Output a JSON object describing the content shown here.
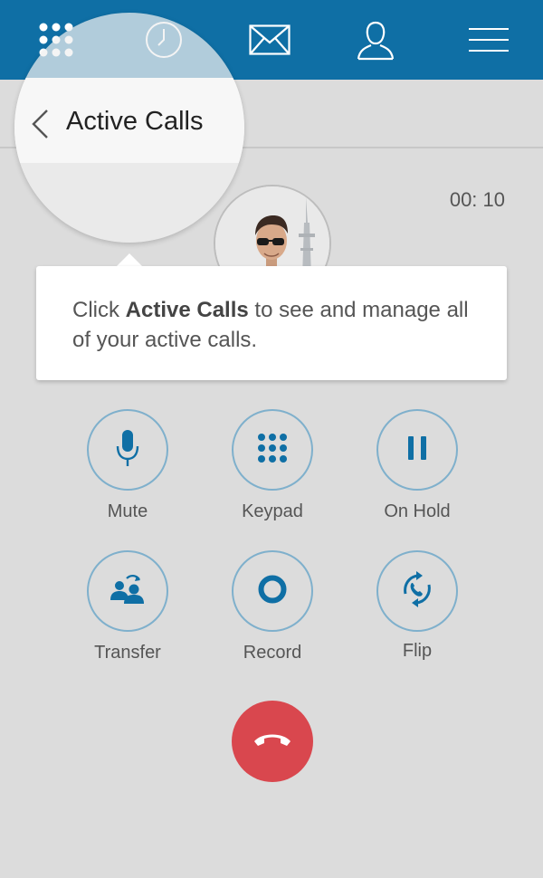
{
  "nav": {
    "items": [
      {
        "icon": "keypad-grid-icon"
      },
      {
        "icon": "clock-icon"
      },
      {
        "icon": "envelope-icon"
      },
      {
        "icon": "contact-icon"
      },
      {
        "icon": "menu-icon"
      }
    ],
    "background": "#0f6fa5"
  },
  "header": {
    "title": "Active Calls",
    "back_icon": "chevron-left-icon"
  },
  "call": {
    "timer": "00: 10"
  },
  "tooltip": {
    "prefix": "Click ",
    "highlight": "Active Calls",
    "suffix": " to see and manage all of your active calls."
  },
  "actions": [
    {
      "label": "Mute",
      "icon": "microphone-icon"
    },
    {
      "label": "Keypad",
      "icon": "keypad-icon"
    },
    {
      "label": "On Hold",
      "icon": "pause-icon"
    },
    {
      "label": "Transfer",
      "icon": "transfer-icon"
    },
    {
      "label": "Record",
      "icon": "record-icon"
    },
    {
      "label": "Flip",
      "icon": "flip-icon"
    }
  ],
  "end_call": {
    "icon": "hang-up-icon",
    "color": "#d9474e"
  },
  "colors": {
    "accent": "#0f6fa5",
    "button_ring": "#7fb0cc",
    "background": "#dcdcdc"
  }
}
